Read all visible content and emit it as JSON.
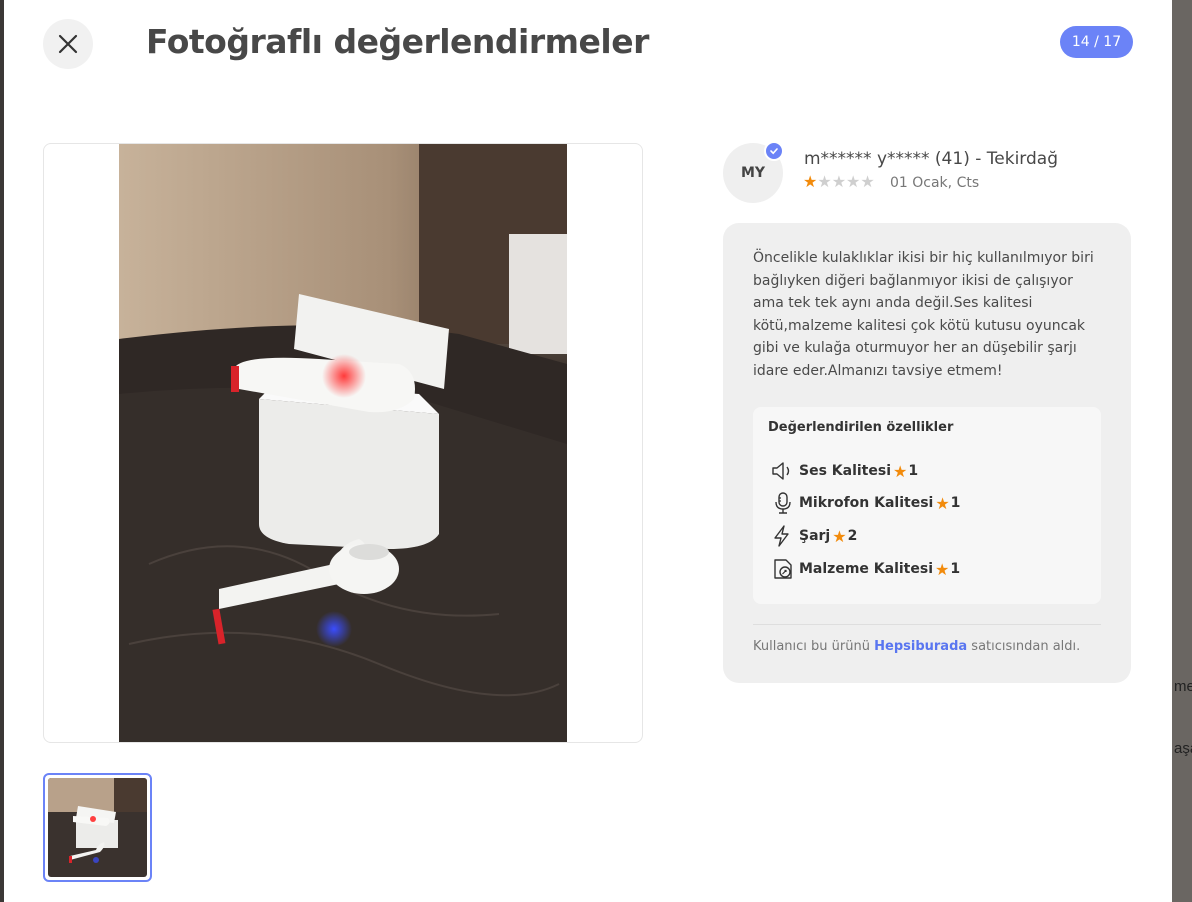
{
  "page": {
    "title": "Fotoğraflı değerlendirmeler",
    "counter": "14 / 17"
  },
  "reviewer": {
    "initials": "MY",
    "name": "m****** y***** (41) - Tekirdağ",
    "date": "01 Ocak, Cts",
    "rating": 1,
    "max_rating": 5
  },
  "review": {
    "text": "Öncelikle kulaklıklar ikisi bir hiç kullanılmıyor biri bağlıyken diğeri bağlanmıyor ikisi de çalışıyor ama tek tek aynı anda değil.Ses kalitesi kötü,malzeme kalitesi çok kötü kutusu oyuncak gibi ve kulağa oturmuyor her an düşebilir şarjı idare eder.Almanızı tavsiye etmem!"
  },
  "features": {
    "title": "Değerlendirilen özellikler",
    "items": [
      {
        "icon": "speaker-icon",
        "label": "Ses Kalitesi",
        "value": "1"
      },
      {
        "icon": "microphone-icon",
        "label": "Mikrofon Kalitesi",
        "value": "1"
      },
      {
        "icon": "lightning-icon",
        "label": "Şarj",
        "value": "2"
      },
      {
        "icon": "material-icon",
        "label": "Malzeme Kalitesi",
        "value": "1"
      }
    ]
  },
  "seller": {
    "prefix": "Kullanıcı bu ürünü",
    "name": "Hepsiburada",
    "suffix": "satıcısından aldı."
  },
  "background_text": [
    "me",
    "aşa"
  ],
  "colors": {
    "accent": "#6b83f7",
    "star": "#f28b0c",
    "star_empty": "#cfcfcf"
  }
}
